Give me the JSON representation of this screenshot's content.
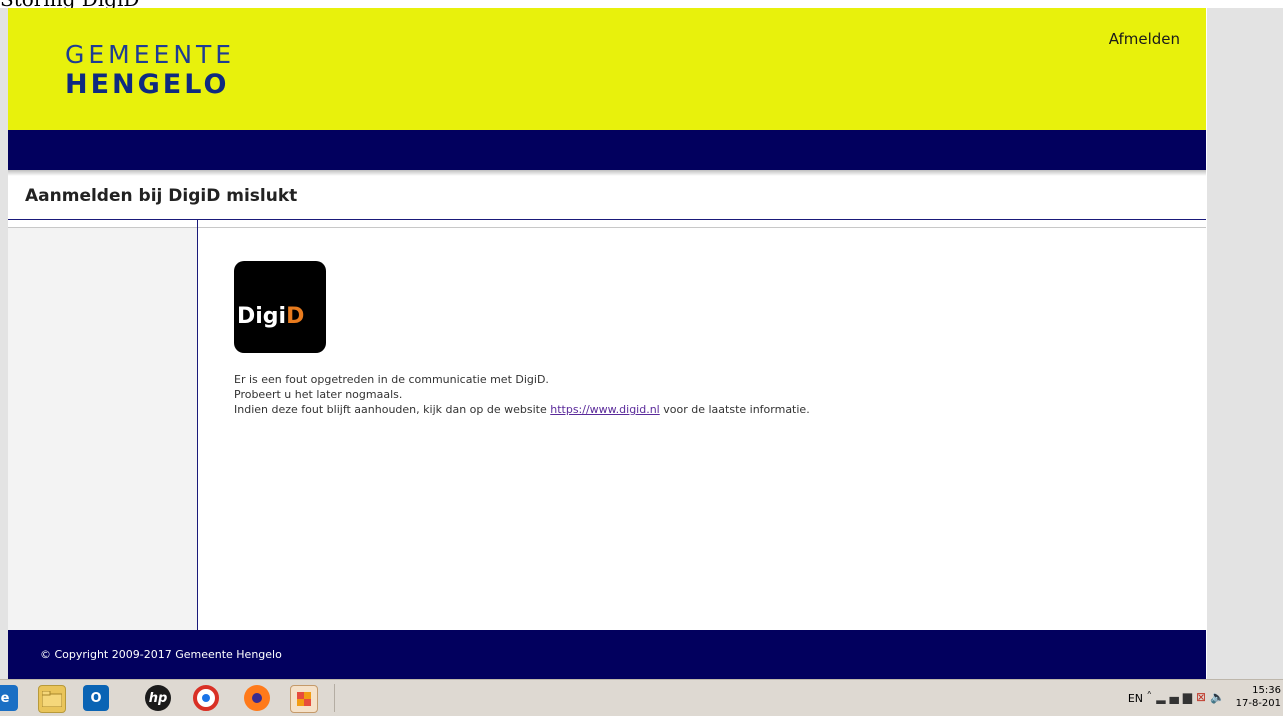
{
  "browser": {
    "tab_title": "Storing DigiD"
  },
  "header": {
    "logo_line1": "GEMEENTE",
    "logo_line2": "HENGELO",
    "logout_label": "Afmelden"
  },
  "page": {
    "title": "Aanmelden bij DigiD mislukt"
  },
  "content": {
    "digid_logo": {
      "part1": "Digi",
      "part2": "D"
    },
    "message_line1": "Er is een fout opgetreden in de communicatie met DigiD.",
    "message_line2": "Probeert u het later nogmaals.",
    "message_line3_pre": "Indien deze fout blijft aanhouden, kijk dan op de website ",
    "message_link": "https://www.digid.nl",
    "message_line3_post": " voor de laatste informatie."
  },
  "footer": {
    "copyright": "© Copyright 2009-2017 Gemeente Hengelo"
  },
  "taskbar": {
    "icons": [
      "edge-icon",
      "file-explorer-icon",
      "outlook-icon",
      "hp-icon",
      "chrome-icon",
      "firefox-icon",
      "snipping-tool-icon"
    ],
    "hp_label": "hp",
    "lang": "EN",
    "time": "15:36",
    "date": "17-8-201"
  },
  "colors": {
    "header_yellow": "#e8f10c",
    "navy": "#02005e",
    "logo_blue": "#1e3c94",
    "digid_orange": "#e87b1e"
  }
}
